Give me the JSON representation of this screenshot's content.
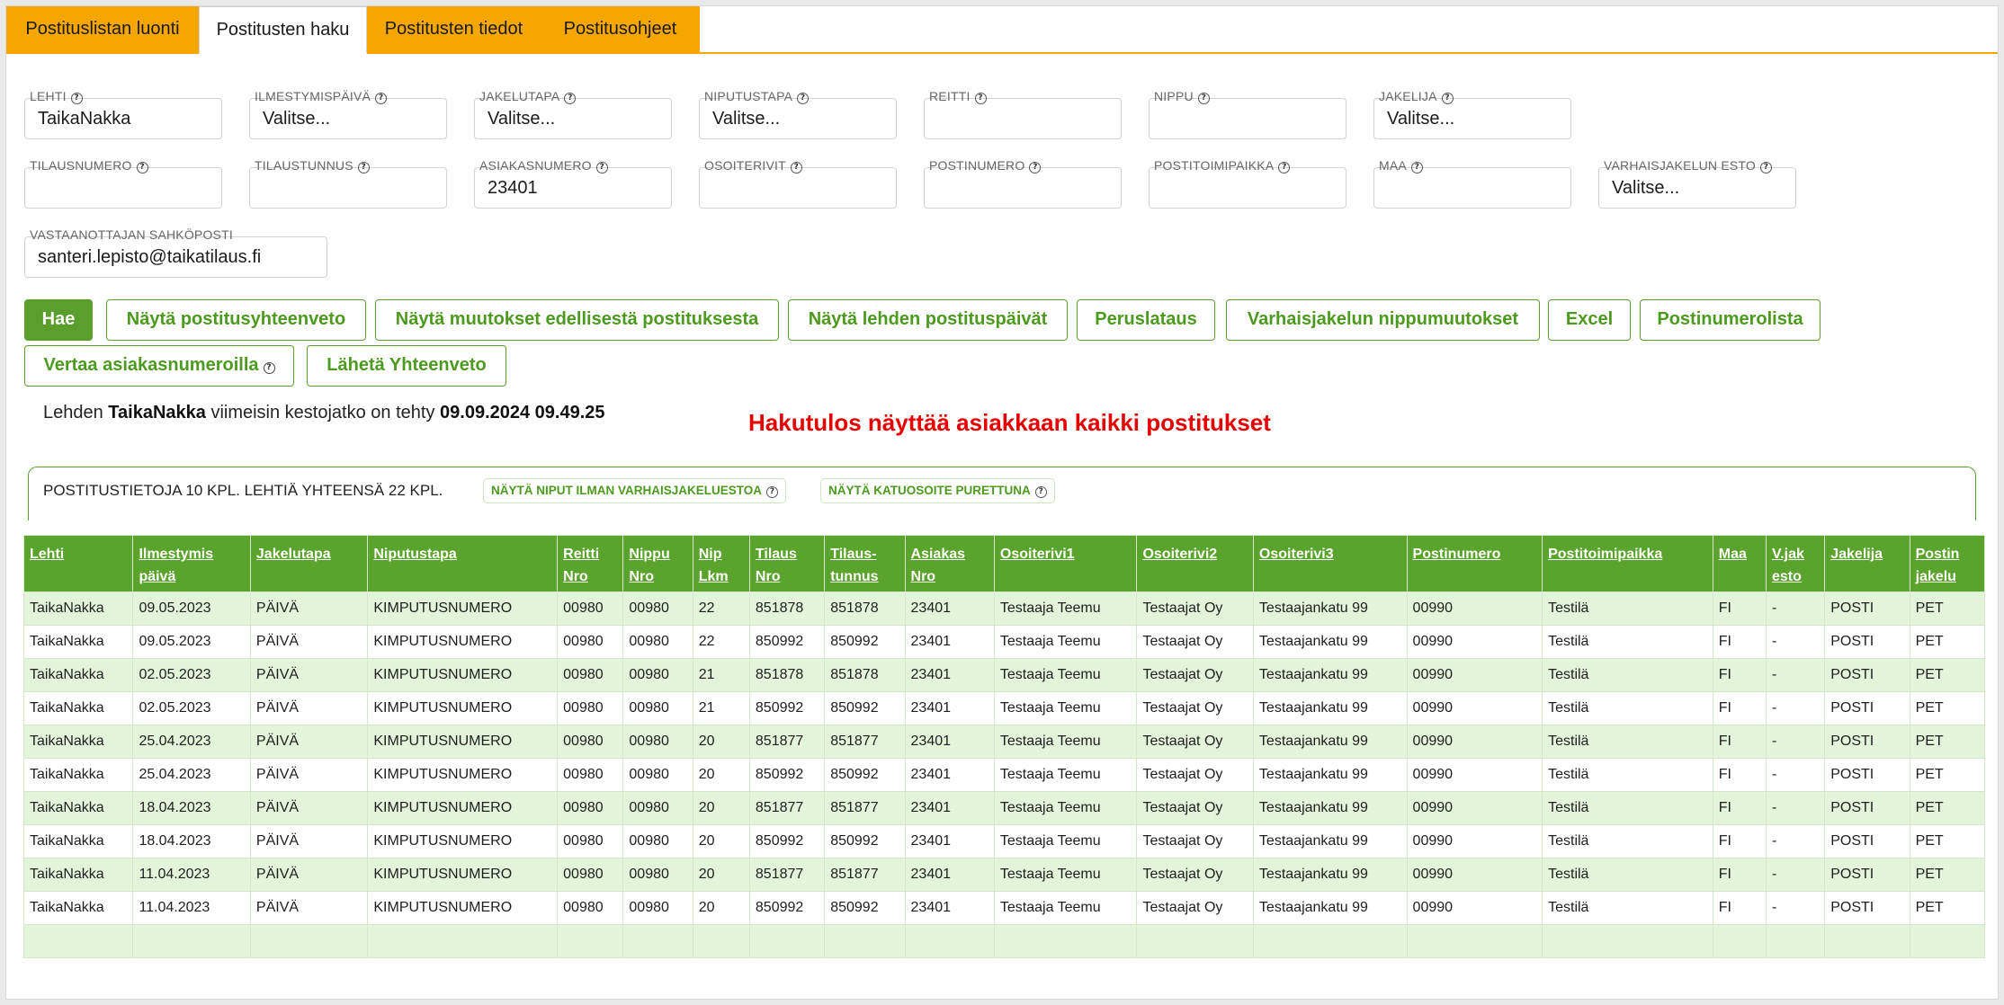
{
  "tabs": [
    {
      "label": "Postituslistan luonti"
    },
    {
      "label": "Postitusten haku"
    },
    {
      "label": "Postitusten tiedot"
    },
    {
      "label": "Postitusohjeet"
    }
  ],
  "form": {
    "lehti": {
      "label": "LEHTI",
      "value": "TaikaNakka"
    },
    "ilmestymispaiva": {
      "label": "ILMESTYMISPÄIVÄ",
      "value": "Valitse..."
    },
    "jakelutapa": {
      "label": "JAKELUTAPA",
      "value": "Valitse..."
    },
    "niputustapa": {
      "label": "NIPUTUSTAPA",
      "value": "Valitse..."
    },
    "reitti": {
      "label": "REITTI",
      "value": ""
    },
    "nippu": {
      "label": "NIPPU",
      "value": ""
    },
    "jakelija": {
      "label": "JAKELIJA",
      "value": "Valitse..."
    },
    "tilausnumero": {
      "label": "TILAUSNUMERO",
      "value": ""
    },
    "tilaustunnus": {
      "label": "TILAUSTUNNUS",
      "value": ""
    },
    "asiakasnumero": {
      "label": "ASIAKASNUMERO",
      "value": "23401"
    },
    "osoiterivit": {
      "label": "OSOITERIVIT",
      "value": ""
    },
    "postinumero": {
      "label": "POSTINUMERO",
      "value": ""
    },
    "postitoimipaikka": {
      "label": "POSTITOIMIPAIKKA",
      "value": ""
    },
    "maa": {
      "label": "MAA",
      "value": ""
    },
    "varhaisjakelun_esto": {
      "label": "VARHAISJAKELUN ESTO",
      "value": "Valitse..."
    },
    "sahkoposti": {
      "label": "VASTAANOTTAJAN SAHKÖPOSTI",
      "value": "santeri.lepisto@taikatilaus.fi"
    }
  },
  "buttons": {
    "hae": "Hae",
    "yhteenveto": "Näytä postitusyhteenveto",
    "muutokset": "Näytä muutokset edellisestä postituksesta",
    "postituspaivat": "Näytä lehden postituspäivät",
    "peruslataus": "Peruslataus",
    "varhaisjakelu": "Varhaisjakelun nippumuutokset",
    "excel": "Excel",
    "postinumerolista": "Postinumerolista",
    "vertaa": "Vertaa asiakasnumeroilla",
    "laheta": "Lähetä Yhteenveto"
  },
  "info": {
    "prefix": "Lehden ",
    "paper": "TaikaNakka",
    "middle": " viimeisin kestojatko on tehty ",
    "datetime": "09.09.2024 09.49.25"
  },
  "note": "Hakutulos näyttää asiakkaan kaikki postitukset",
  "summary": {
    "text": "POSTITUSTIETOJA 10 KPL. LEHTIÄ YHTEENSÄ 22 KPL.",
    "pill1": "NÄYTÄ NIPUT ILMAN VARHAISJAKELUESTOA",
    "pill2": "NÄYTÄ KATUOSOITE PURETTUNA"
  },
  "table": {
    "headers": [
      [
        "Lehti"
      ],
      [
        "Ilmestymis",
        "päivä"
      ],
      [
        "Jakelutapa"
      ],
      [
        "Niputustapa"
      ],
      [
        "Reitti",
        "Nro"
      ],
      [
        "Nippu",
        "Nro"
      ],
      [
        "Nip",
        "Lkm"
      ],
      [
        "Tilaus",
        "Nro"
      ],
      [
        "Tilaus-",
        "tunnus"
      ],
      [
        "Asiakas",
        "Nro"
      ],
      [
        "Osoiterivi1"
      ],
      [
        "Osoiterivi2"
      ],
      [
        "Osoiterivi3"
      ],
      [
        "Postinumero"
      ],
      [
        "Postitoimipaikka"
      ],
      [
        "Maa"
      ],
      [
        "V.jak",
        "esto"
      ],
      [
        "Jakelija"
      ],
      [
        "Postin",
        "jakelu"
      ]
    ],
    "rows": [
      [
        "TaikaNakka",
        "09.05.2023",
        "PÄIVÄ",
        "KIMPUTUSNUMERO",
        "00980",
        "00980",
        "22",
        "851878",
        "851878",
        "23401",
        "Testaaja Teemu",
        "Testaajat Oy",
        "Testaajankatu 99",
        "00990",
        "Testilä",
        "FI",
        "-",
        "POSTI",
        "PET"
      ],
      [
        "TaikaNakka",
        "09.05.2023",
        "PÄIVÄ",
        "KIMPUTUSNUMERO",
        "00980",
        "00980",
        "22",
        "850992",
        "850992",
        "23401",
        "Testaaja Teemu",
        "Testaajat Oy",
        "Testaajankatu 99",
        "00990",
        "Testilä",
        "FI",
        "-",
        "POSTI",
        "PET"
      ],
      [
        "TaikaNakka",
        "02.05.2023",
        "PÄIVÄ",
        "KIMPUTUSNUMERO",
        "00980",
        "00980",
        "21",
        "851878",
        "851878",
        "23401",
        "Testaaja Teemu",
        "Testaajat Oy",
        "Testaajankatu 99",
        "00990",
        "Testilä",
        "FI",
        "-",
        "POSTI",
        "PET"
      ],
      [
        "TaikaNakka",
        "02.05.2023",
        "PÄIVÄ",
        "KIMPUTUSNUMERO",
        "00980",
        "00980",
        "21",
        "850992",
        "850992",
        "23401",
        "Testaaja Teemu",
        "Testaajat Oy",
        "Testaajankatu 99",
        "00990",
        "Testilä",
        "FI",
        "-",
        "POSTI",
        "PET"
      ],
      [
        "TaikaNakka",
        "25.04.2023",
        "PÄIVÄ",
        "KIMPUTUSNUMERO",
        "00980",
        "00980",
        "20",
        "851877",
        "851877",
        "23401",
        "Testaaja Teemu",
        "Testaajat Oy",
        "Testaajankatu 99",
        "00990",
        "Testilä",
        "FI",
        "-",
        "POSTI",
        "PET"
      ],
      [
        "TaikaNakka",
        "25.04.2023",
        "PÄIVÄ",
        "KIMPUTUSNUMERO",
        "00980",
        "00980",
        "20",
        "850992",
        "850992",
        "23401",
        "Testaaja Teemu",
        "Testaajat Oy",
        "Testaajankatu 99",
        "00990",
        "Testilä",
        "FI",
        "-",
        "POSTI",
        "PET"
      ],
      [
        "TaikaNakka",
        "18.04.2023",
        "PÄIVÄ",
        "KIMPUTUSNUMERO",
        "00980",
        "00980",
        "20",
        "851877",
        "851877",
        "23401",
        "Testaaja Teemu",
        "Testaajat Oy",
        "Testaajankatu 99",
        "00990",
        "Testilä",
        "FI",
        "-",
        "POSTI",
        "PET"
      ],
      [
        "TaikaNakka",
        "18.04.2023",
        "PÄIVÄ",
        "KIMPUTUSNUMERO",
        "00980",
        "00980",
        "20",
        "850992",
        "850992",
        "23401",
        "Testaaja Teemu",
        "Testaajat Oy",
        "Testaajankatu 99",
        "00990",
        "Testilä",
        "FI",
        "-",
        "POSTI",
        "PET"
      ],
      [
        "TaikaNakka",
        "11.04.2023",
        "PÄIVÄ",
        "KIMPUTUSNUMERO",
        "00980",
        "00980",
        "20",
        "851877",
        "851877",
        "23401",
        "Testaaja Teemu",
        "Testaajat Oy",
        "Testaajankatu 99",
        "00990",
        "Testilä",
        "FI",
        "-",
        "POSTI",
        "PET"
      ],
      [
        "TaikaNakka",
        "11.04.2023",
        "PÄIVÄ",
        "KIMPUTUSNUMERO",
        "00980",
        "00980",
        "20",
        "850992",
        "850992",
        "23401",
        "Testaaja Teemu",
        "Testaajat Oy",
        "Testaajankatu 99",
        "00990",
        "Testilä",
        "FI",
        "-",
        "POSTI",
        "PET"
      ]
    ]
  },
  "colors": {
    "tab_orange": "#f5a700",
    "accent_green": "#5aa32c",
    "row_green": "#e2f5da",
    "note_red": "#e60000"
  },
  "icons": {
    "help": "help-circle-icon"
  }
}
